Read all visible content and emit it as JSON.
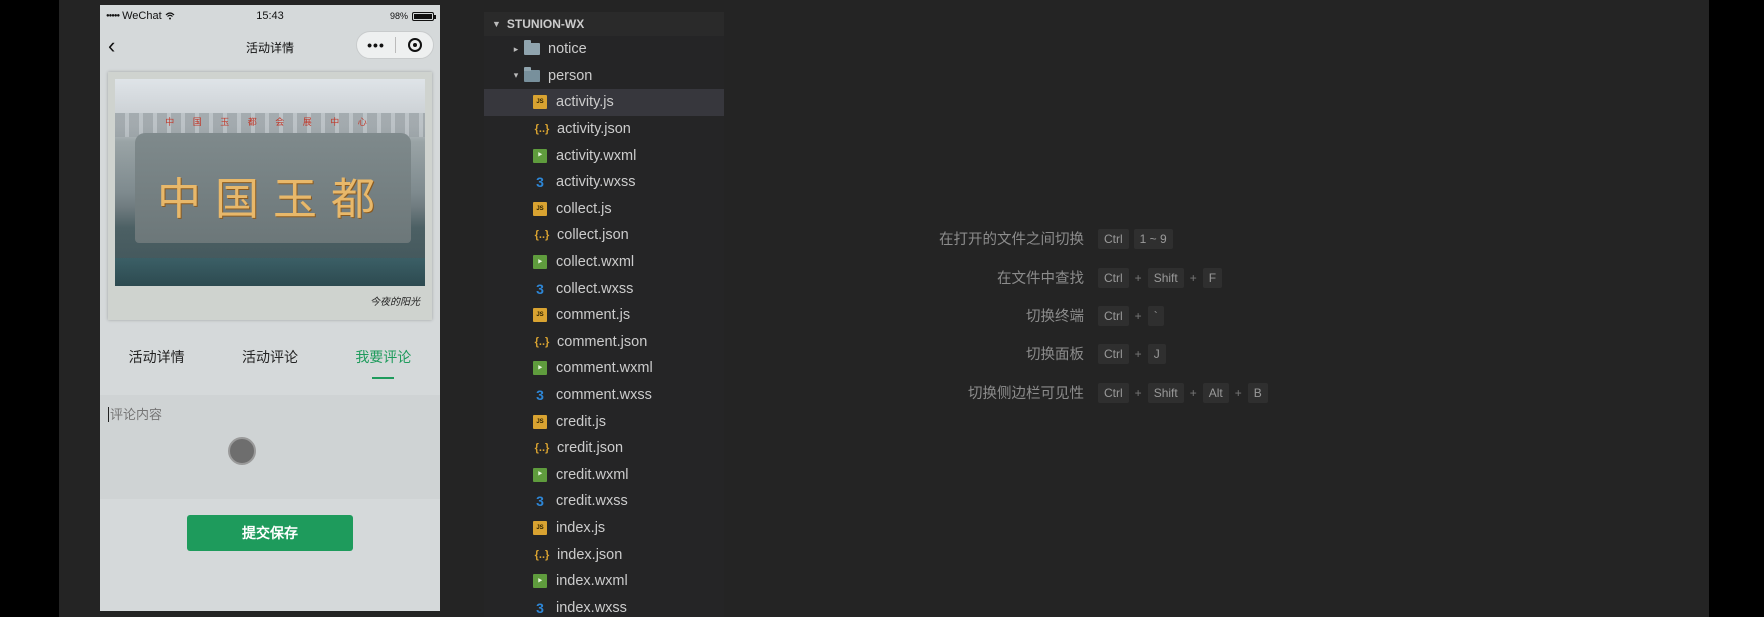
{
  "simulator": {
    "status_bar": {
      "signal": "●●●●●",
      "carrier": "WeChat",
      "wifi": "wifi-icon",
      "time": "15:43",
      "battery_percent": "98%",
      "battery_level": 0.98
    },
    "nav": {
      "back_icon": "chevron-left-icon",
      "title": "活动详情",
      "more": "•••",
      "close_icon": "target-icon"
    },
    "photo": {
      "sign_text": "中 国 玉 都 会 展 中 心",
      "stone_text": "中国玉都",
      "caption": "今夜的阳光"
    },
    "tabs": [
      {
        "label": "活动详情",
        "active": false
      },
      {
        "label": "活动评论",
        "active": false
      },
      {
        "label": "我要评论",
        "active": true
      }
    ],
    "comment": {
      "placeholder": "评论内容",
      "value": ""
    },
    "submit_label": "提交保存",
    "accent_color": "#1e9b5c"
  },
  "explorer": {
    "title": "STUNION-WX",
    "items": [
      {
        "name": "notice",
        "type": "folder",
        "open": false,
        "depth": 1,
        "selected": false
      },
      {
        "name": "person",
        "type": "folder",
        "open": true,
        "depth": 1,
        "selected": false
      },
      {
        "name": "activity.js",
        "type": "js",
        "depth": 2,
        "selected": true
      },
      {
        "name": "activity.json",
        "type": "json",
        "depth": 2,
        "selected": false
      },
      {
        "name": "activity.wxml",
        "type": "wxml",
        "depth": 2,
        "selected": false
      },
      {
        "name": "activity.wxss",
        "type": "wxss",
        "depth": 2,
        "selected": false
      },
      {
        "name": "collect.js",
        "type": "js",
        "depth": 2,
        "selected": false
      },
      {
        "name": "collect.json",
        "type": "json",
        "depth": 2,
        "selected": false
      },
      {
        "name": "collect.wxml",
        "type": "wxml",
        "depth": 2,
        "selected": false
      },
      {
        "name": "collect.wxss",
        "type": "wxss",
        "depth": 2,
        "selected": false
      },
      {
        "name": "comment.js",
        "type": "js",
        "depth": 2,
        "selected": false
      },
      {
        "name": "comment.json",
        "type": "json",
        "depth": 2,
        "selected": false
      },
      {
        "name": "comment.wxml",
        "type": "wxml",
        "depth": 2,
        "selected": false
      },
      {
        "name": "comment.wxss",
        "type": "wxss",
        "depth": 2,
        "selected": false
      },
      {
        "name": "credit.js",
        "type": "js",
        "depth": 2,
        "selected": false
      },
      {
        "name": "credit.json",
        "type": "json",
        "depth": 2,
        "selected": false
      },
      {
        "name": "credit.wxml",
        "type": "wxml",
        "depth": 2,
        "selected": false
      },
      {
        "name": "credit.wxss",
        "type": "wxss",
        "depth": 2,
        "selected": false
      },
      {
        "name": "index.js",
        "type": "js",
        "depth": 2,
        "selected": false
      },
      {
        "name": "index.json",
        "type": "json",
        "depth": 2,
        "selected": false
      },
      {
        "name": "index.wxml",
        "type": "wxml",
        "depth": 2,
        "selected": false
      },
      {
        "name": "index.wxss",
        "type": "wxss",
        "depth": 2,
        "selected": false
      }
    ]
  },
  "shortcuts": [
    {
      "label": "在打开的文件之间切换",
      "keys": [
        "Ctrl",
        "1 ~ 9"
      ],
      "joined": false
    },
    {
      "label": "在文件中查找",
      "keys": [
        "Ctrl",
        "Shift",
        "F"
      ],
      "joined": true
    },
    {
      "label": "切换终端",
      "keys": [
        "Ctrl",
        "`"
      ],
      "joined": true
    },
    {
      "label": "切换面板",
      "keys": [
        "Ctrl",
        "J"
      ],
      "joined": true
    },
    {
      "label": "切换侧边栏可见性",
      "keys": [
        "Ctrl",
        "Shift",
        "Alt",
        "B"
      ],
      "joined": true
    }
  ],
  "shortcut_plus": "+"
}
